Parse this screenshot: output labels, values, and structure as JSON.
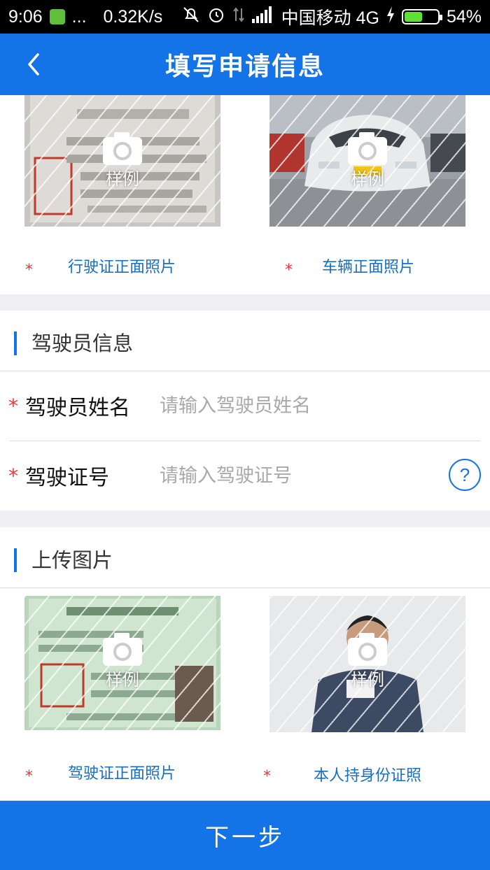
{
  "status_bar": {
    "time": "9:06",
    "dots": "...",
    "speed": "0.32K/s",
    "carrier": "中国移动 4G",
    "battery": "54%",
    "battery_level": 0.54
  },
  "nav": {
    "title": "填写申请信息"
  },
  "vehicle_photos": [
    {
      "caption": "行驶证正面照片",
      "sample": "样例"
    },
    {
      "caption": "车辆正面照片",
      "sample": "样例"
    }
  ],
  "driver_section": {
    "title": "驾驶员信息",
    "name_label": "驾驶员姓名",
    "name_placeholder": "请输入驾驶员姓名",
    "license_label": "驾驶证号",
    "license_placeholder": "请输入驾驶证号",
    "help": "?"
  },
  "upload_section": {
    "title": "上传图片",
    "photos": [
      {
        "caption": "驾驶证正面照片",
        "sample": "样例"
      },
      {
        "caption": "本人持身份证照",
        "sample": "样例"
      }
    ]
  },
  "next_button": "下一步",
  "colors": {
    "primary": "#1473e6",
    "required": "#e8393a",
    "caption": "#1a6ec0"
  },
  "icons": [
    "back-chevron-icon",
    "camera-icon",
    "help-icon"
  ]
}
